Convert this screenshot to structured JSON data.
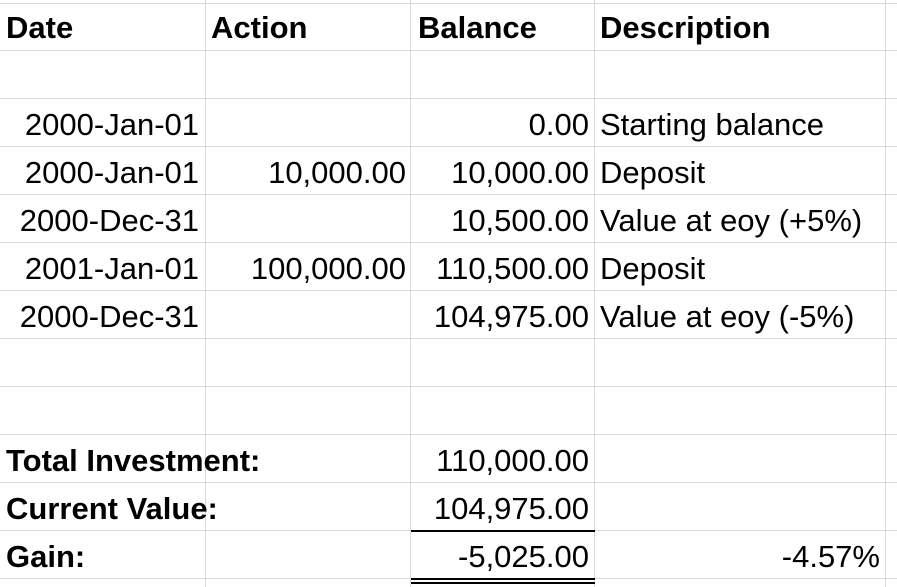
{
  "headers": {
    "date": "Date",
    "action": "Action",
    "balance": "Balance",
    "description": "Description"
  },
  "rows": [
    {
      "date": "2000-Jan-01",
      "action": "",
      "balance": "0.00",
      "description": "Starting balance"
    },
    {
      "date": "2000-Jan-01",
      "action": "10,000.00",
      "balance": "10,000.00",
      "description": "Deposit"
    },
    {
      "date": "2000-Dec-31",
      "action": "",
      "balance": "10,500.00",
      "description": "Value at eoy (+5%)"
    },
    {
      "date": "2001-Jan-01",
      "action": "100,000.00",
      "balance": "110,500.00",
      "description": "Deposit"
    },
    {
      "date": "2000-Dec-31",
      "action": "",
      "balance": "104,975.00",
      "description": "Value at eoy (-5%)"
    }
  ],
  "summary": {
    "total_investment_label": "Total Investment:",
    "total_investment_value": "110,000.00",
    "current_value_label": "Current Value:",
    "current_value_value": "104,975.00",
    "gain_label": "Gain:",
    "gain_value": "-5,025.00",
    "gain_percent": "-4.57%"
  }
}
